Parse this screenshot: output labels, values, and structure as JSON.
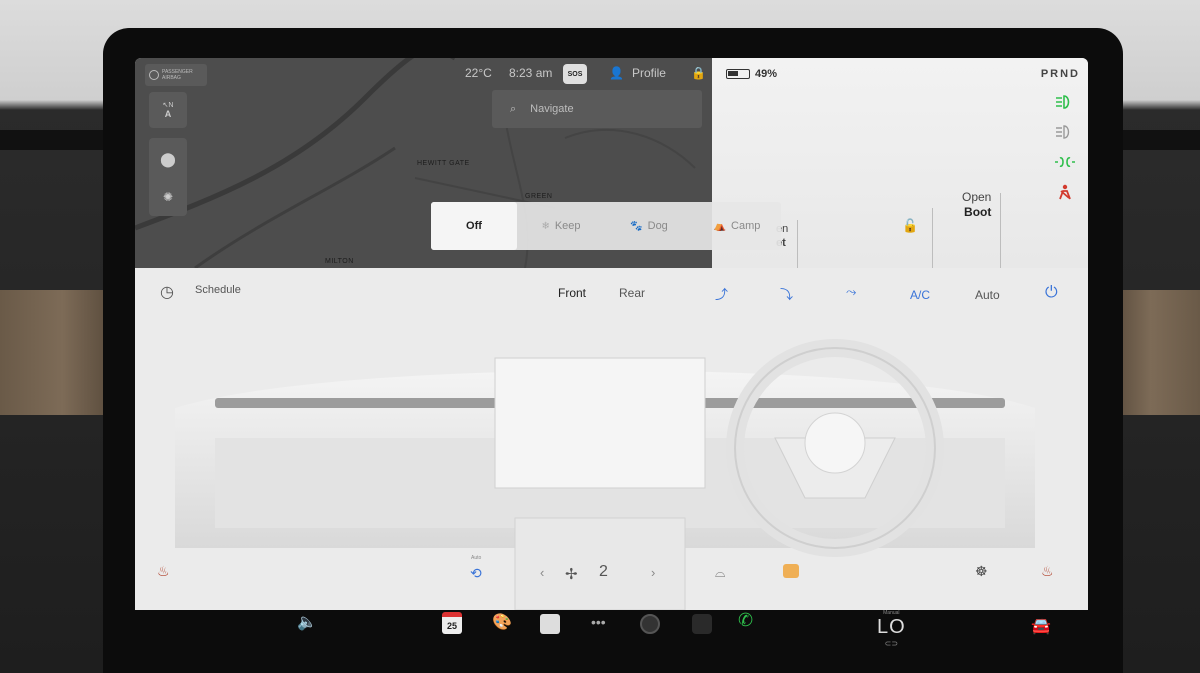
{
  "map": {
    "passenger_airbag": [
      "PASSENGER",
      "AIRBAG"
    ],
    "temperature": "22°C",
    "time": "8:23 am",
    "sos_label": "SOS",
    "profile_label": "Profile",
    "navigate_placeholder": "Navigate",
    "compass_letter": "A",
    "labels": [
      "HEWITT GATE",
      "GREEN",
      "MILTON"
    ]
  },
  "vehicle": {
    "battery_percent": "49%",
    "battery_level": 0.49,
    "gear": "PRND",
    "open_boot_line1": "Open",
    "open_boot_line2": "Boot",
    "frunk_partial_line1": "en",
    "frunk_partial_line2": "et"
  },
  "keep_modes": [
    {
      "label": "Off",
      "active": true
    },
    {
      "label": "Keep",
      "active": false
    },
    {
      "label": "Dog",
      "active": false
    },
    {
      "label": "Camp",
      "active": false
    }
  ],
  "climate": {
    "schedule_label": "Schedule",
    "front_label": "Front",
    "rear_label": "Rear",
    "ac_label": "A/C",
    "auto_label": "Auto",
    "fan_speed": "2",
    "recirc_label": "Auto"
  },
  "taskbar": {
    "calendar_day": "25",
    "temp_display": "LO",
    "temp_small": "Manual"
  },
  "colors": {
    "accent_blue": "#3a74d8",
    "light_green": "#2fbf4c",
    "seatbelt_red": "#d23a2e",
    "defrost_orange": "#f0a030"
  }
}
